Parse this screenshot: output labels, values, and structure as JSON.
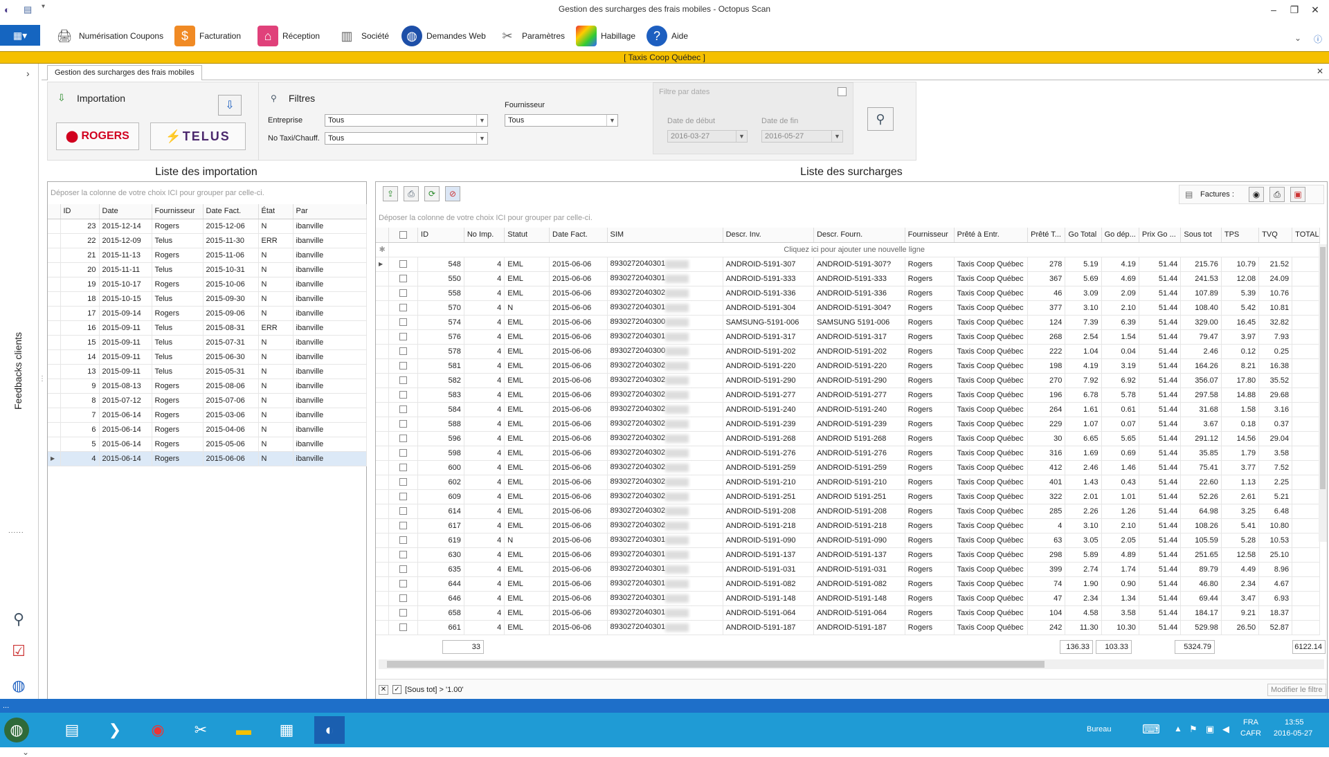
{
  "window": {
    "title": "Gestion des surcharges des frais mobiles - Octopus Scan"
  },
  "ribbon": {
    "app_menu_label": "▦▾",
    "items": [
      {
        "label": "Numérisation Coupons",
        "icon": "scanner-icon"
      },
      {
        "label": "Facturation",
        "icon": "invoice-icon"
      },
      {
        "label": "Réception",
        "icon": "house-icon"
      },
      {
        "label": "Société",
        "icon": "building-icon"
      },
      {
        "label": "Demandes Web",
        "icon": "globe-icon"
      },
      {
        "label": "Paramètres",
        "icon": "tools-icon"
      },
      {
        "label": "Habillage",
        "icon": "palette-icon"
      },
      {
        "label": "Aide",
        "icon": "help-icon"
      }
    ]
  },
  "banner": {
    "text": "[   Taxis Coop Québec   ]"
  },
  "sidebar": {
    "label": "Feedbacks clients"
  },
  "tab": {
    "label": "Gestion des surcharges des frais mobiles"
  },
  "importation": {
    "title": "Importation",
    "rogers": "ROGERS",
    "telus": "TELUS"
  },
  "filters": {
    "title": "Filtres",
    "entreprise_label": "Entreprise",
    "entreprise_value": "Tous",
    "taxi_label": "No Taxi/Chauff.",
    "taxi_value": "Tous",
    "fournisseur_label": "Fournisseur",
    "fournisseur_value": "Tous",
    "dates_title": "Filtre par dates",
    "date_debut_label": "Date de début",
    "date_debut_value": "2016-03-27",
    "date_fin_label": "Date de fin",
    "date_fin_value": "2016-05-27"
  },
  "imports": {
    "title": "Liste des importation",
    "group_hint": "Déposer la colonne de votre choix ICI pour grouper par celle-ci.",
    "columns": [
      "ID",
      "Date",
      "Fournisseur",
      "Date Fact.",
      "État",
      "Par"
    ],
    "rows": [
      [
        "23",
        "2015-12-14",
        "Rogers",
        "2015-12-06",
        "N",
        "ibanville"
      ],
      [
        "22",
        "2015-12-09",
        "Telus",
        "2015-11-30",
        "ERR",
        "ibanville"
      ],
      [
        "21",
        "2015-11-13",
        "Rogers",
        "2015-11-06",
        "N",
        "ibanville"
      ],
      [
        "20",
        "2015-11-11",
        "Telus",
        "2015-10-31",
        "N",
        "ibanville"
      ],
      [
        "19",
        "2015-10-17",
        "Rogers",
        "2015-10-06",
        "N",
        "ibanville"
      ],
      [
        "18",
        "2015-10-15",
        "Telus",
        "2015-09-30",
        "N",
        "ibanville"
      ],
      [
        "17",
        "2015-09-14",
        "Rogers",
        "2015-09-06",
        "N",
        "ibanville"
      ],
      [
        "16",
        "2015-09-11",
        "Telus",
        "2015-08-31",
        "ERR",
        "ibanville"
      ],
      [
        "15",
        "2015-09-11",
        "Telus",
        "2015-07-31",
        "N",
        "ibanville"
      ],
      [
        "14",
        "2015-09-11",
        "Telus",
        "2015-06-30",
        "N",
        "ibanville"
      ],
      [
        "13",
        "2015-09-11",
        "Telus",
        "2015-05-31",
        "N",
        "ibanville"
      ],
      [
        "9",
        "2015-08-13",
        "Rogers",
        "2015-08-06",
        "N",
        "ibanville"
      ],
      [
        "8",
        "2015-07-12",
        "Rogers",
        "2015-07-06",
        "N",
        "ibanville"
      ],
      [
        "7",
        "2015-06-14",
        "Rogers",
        "2015-03-06",
        "N",
        "ibanville"
      ],
      [
        "6",
        "2015-06-14",
        "Rogers",
        "2015-04-06",
        "N",
        "ibanville"
      ],
      [
        "5",
        "2015-06-14",
        "Rogers",
        "2015-05-06",
        "N",
        "ibanville"
      ],
      [
        "4",
        "2015-06-14",
        "Rogers",
        "2015-06-06",
        "N",
        "ibanville"
      ]
    ]
  },
  "surcharges": {
    "title": "Liste des surcharges",
    "group_hint": "Déposer la colonne de votre choix ICI pour grouper par celle-ci.",
    "factures_label": "Factures :",
    "new_row_hint": "Cliquez ici pour ajouter une nouvelle ligne",
    "columns": [
      "ID",
      "No Imp.",
      "Statut",
      "Date Fact.",
      "SIM",
      "Descr. Inv.",
      "Descr. Fourn.",
      "Fournisseur",
      "Prêté à Entr.",
      "Prêté T...",
      "Go Total",
      "Go dép...",
      "Prix Go ...",
      "Sous tot",
      "TPS",
      "TVQ",
      "TOTAL"
    ],
    "rows": [
      [
        "548",
        "4",
        "EML",
        "2015-06-06",
        "8930272040301",
        "ANDROID-5191-307",
        "ANDROID-5191-307?",
        "Rogers",
        "Taxis Coop Québec",
        "278",
        "5.19",
        "4.19",
        "51.44",
        "215.76",
        "10.79",
        "21.52"
      ],
      [
        "550",
        "4",
        "EML",
        "2015-06-06",
        "8930272040301",
        "ANDROID-5191-333",
        "ANDROID-5191-333",
        "Rogers",
        "Taxis Coop Québec",
        "367",
        "5.69",
        "4.69",
        "51.44",
        "241.53",
        "12.08",
        "24.09"
      ],
      [
        "558",
        "4",
        "EML",
        "2015-06-06",
        "8930272040302",
        "ANDROID-5191-336",
        "ANDROID-5191-336",
        "Rogers",
        "Taxis Coop Québec",
        "46",
        "3.09",
        "2.09",
        "51.44",
        "107.89",
        "5.39",
        "10.76"
      ],
      [
        "570",
        "4",
        "N",
        "2015-06-06",
        "8930272040301",
        "ANDROID-5191-304",
        "ANDROID-5191-304?",
        "Rogers",
        "Taxis Coop Québec",
        "377",
        "3.10",
        "2.10",
        "51.44",
        "108.40",
        "5.42",
        "10.81"
      ],
      [
        "574",
        "4",
        "EML",
        "2015-06-06",
        "8930272040300",
        "SAMSUNG-5191-006",
        "SAMSUNG 5191-006",
        "Rogers",
        "Taxis Coop Québec",
        "124",
        "7.39",
        "6.39",
        "51.44",
        "329.00",
        "16.45",
        "32.82"
      ],
      [
        "576",
        "4",
        "EML",
        "2015-06-06",
        "8930272040301",
        "ANDROID-5191-317",
        "ANDROID-5191-317",
        "Rogers",
        "Taxis Coop Québec",
        "268",
        "2.54",
        "1.54",
        "51.44",
        "79.47",
        "3.97",
        "7.93"
      ],
      [
        "578",
        "4",
        "EML",
        "2015-06-06",
        "8930272040300",
        "ANDROID-5191-202",
        "ANDROID-5191-202",
        "Rogers",
        "Taxis Coop Québec",
        "222",
        "1.04",
        "0.04",
        "51.44",
        "2.46",
        "0.12",
        "0.25"
      ],
      [
        "581",
        "4",
        "EML",
        "2015-06-06",
        "8930272040302",
        "ANDROID-5191-220",
        "ANDROID-5191-220",
        "Rogers",
        "Taxis Coop Québec",
        "198",
        "4.19",
        "3.19",
        "51.44",
        "164.26",
        "8.21",
        "16.38"
      ],
      [
        "582",
        "4",
        "EML",
        "2015-06-06",
        "8930272040302",
        "ANDROID-5191-290",
        "ANDROID-5191-290",
        "Rogers",
        "Taxis Coop Québec",
        "270",
        "7.92",
        "6.92",
        "51.44",
        "356.07",
        "17.80",
        "35.52"
      ],
      [
        "583",
        "4",
        "EML",
        "2015-06-06",
        "8930272040302",
        "ANDROID-5191-277",
        "ANDROID-5191-277",
        "Rogers",
        "Taxis Coop Québec",
        "196",
        "6.78",
        "5.78",
        "51.44",
        "297.58",
        "14.88",
        "29.68"
      ],
      [
        "584",
        "4",
        "EML",
        "2015-06-06",
        "8930272040302",
        "ANDROID-5191-240",
        "ANDROID-5191-240",
        "Rogers",
        "Taxis Coop Québec",
        "264",
        "1.61",
        "0.61",
        "51.44",
        "31.68",
        "1.58",
        "3.16"
      ],
      [
        "588",
        "4",
        "EML",
        "2015-06-06",
        "8930272040302",
        "ANDROID-5191-239",
        "ANDROID-5191-239",
        "Rogers",
        "Taxis Coop Québec",
        "229",
        "1.07",
        "0.07",
        "51.44",
        "3.67",
        "0.18",
        "0.37"
      ],
      [
        "596",
        "4",
        "EML",
        "2015-06-06",
        "8930272040302",
        "ANDROID-5191-268",
        "ANDROID 5191-268",
        "Rogers",
        "Taxis Coop Québec",
        "30",
        "6.65",
        "5.65",
        "51.44",
        "291.12",
        "14.56",
        "29.04"
      ],
      [
        "598",
        "4",
        "EML",
        "2015-06-06",
        "8930272040302",
        "ANDROID-5191-276",
        "ANDROID-5191-276",
        "Rogers",
        "Taxis Coop Québec",
        "316",
        "1.69",
        "0.69",
        "51.44",
        "35.85",
        "1.79",
        "3.58"
      ],
      [
        "600",
        "4",
        "EML",
        "2015-06-06",
        "8930272040302",
        "ANDROID-5191-259",
        "ANDROID-5191-259",
        "Rogers",
        "Taxis Coop Québec",
        "412",
        "2.46",
        "1.46",
        "51.44",
        "75.41",
        "3.77",
        "7.52"
      ],
      [
        "602",
        "4",
        "EML",
        "2015-06-06",
        "8930272040302",
        "ANDROID-5191-210",
        "ANDROID-5191-210",
        "Rogers",
        "Taxis Coop Québec",
        "401",
        "1.43",
        "0.43",
        "51.44",
        "22.60",
        "1.13",
        "2.25"
      ],
      [
        "609",
        "4",
        "EML",
        "2015-06-06",
        "8930272040302",
        "ANDROID-5191-251",
        "ANDROID 5191-251",
        "Rogers",
        "Taxis Coop Québec",
        "322",
        "2.01",
        "1.01",
        "51.44",
        "52.26",
        "2.61",
        "5.21"
      ],
      [
        "614",
        "4",
        "EML",
        "2015-06-06",
        "8930272040302",
        "ANDROID-5191-208",
        "ANDROID-5191-208",
        "Rogers",
        "Taxis Coop Québec",
        "285",
        "2.26",
        "1.26",
        "51.44",
        "64.98",
        "3.25",
        "6.48"
      ],
      [
        "617",
        "4",
        "EML",
        "2015-06-06",
        "8930272040302",
        "ANDROID-5191-218",
        "ANDROID-5191-218",
        "Rogers",
        "Taxis Coop Québec",
        "4",
        "3.10",
        "2.10",
        "51.44",
        "108.26",
        "5.41",
        "10.80"
      ],
      [
        "619",
        "4",
        "N",
        "2015-06-06",
        "8930272040301",
        "ANDROID-5191-090",
        "ANDROID-5191-090",
        "Rogers",
        "Taxis Coop Québec",
        "63",
        "3.05",
        "2.05",
        "51.44",
        "105.59",
        "5.28",
        "10.53"
      ],
      [
        "630",
        "4",
        "EML",
        "2015-06-06",
        "8930272040301",
        "ANDROID-5191-137",
        "ANDROID-5191-137",
        "Rogers",
        "Taxis Coop Québec",
        "298",
        "5.89",
        "4.89",
        "51.44",
        "251.65",
        "12.58",
        "25.10"
      ],
      [
        "635",
        "4",
        "EML",
        "2015-06-06",
        "8930272040301",
        "ANDROID-5191-031",
        "ANDROID-5191-031",
        "Rogers",
        "Taxis Coop Québec",
        "399",
        "2.74",
        "1.74",
        "51.44",
        "89.79",
        "4.49",
        "8.96"
      ],
      [
        "644",
        "4",
        "EML",
        "2015-06-06",
        "8930272040301",
        "ANDROID-5191-082",
        "ANDROID-5191-082",
        "Rogers",
        "Taxis Coop Québec",
        "74",
        "1.90",
        "0.90",
        "51.44",
        "46.80",
        "2.34",
        "4.67"
      ],
      [
        "646",
        "4",
        "EML",
        "2015-06-06",
        "8930272040301",
        "ANDROID-5191-148",
        "ANDROID-5191-148",
        "Rogers",
        "Taxis Coop Québec",
        "47",
        "2.34",
        "1.34",
        "51.44",
        "69.44",
        "3.47",
        "6.93"
      ],
      [
        "658",
        "4",
        "EML",
        "2015-06-06",
        "8930272040301",
        "ANDROID-5191-064",
        "ANDROID-5191-064",
        "Rogers",
        "Taxis Coop Québec",
        "104",
        "4.58",
        "3.58",
        "51.44",
        "184.17",
        "9.21",
        "18.37"
      ],
      [
        "661",
        "4",
        "EML",
        "2015-06-06",
        "8930272040301",
        "ANDROID-5191-187",
        "ANDROID-5191-187",
        "Rogers",
        "Taxis Coop Québec",
        "242",
        "11.30",
        "10.30",
        "51.44",
        "529.98",
        "26.50",
        "52.87"
      ]
    ],
    "totals": {
      "count": "33",
      "go_total": "136.33",
      "go_dep": "103.33",
      "sous_tot": "5324.79",
      "total": "6122.14"
    },
    "filter_text": "[Sous tot] > '1.00'",
    "modify_filter": "Modifier le filtre"
  },
  "taskbar": {
    "bureau": "Bureau",
    "lang": "FRA",
    "layout": "CAFR",
    "time": "13:55",
    "date": "2016-05-27"
  }
}
